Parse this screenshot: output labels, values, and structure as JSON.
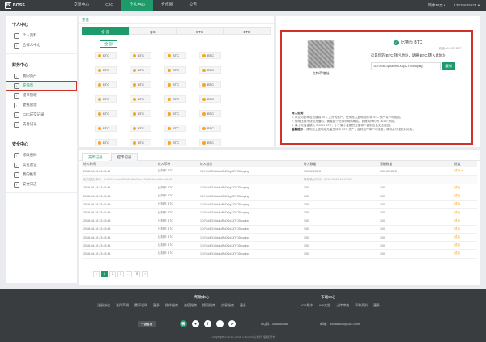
{
  "header": {
    "logo_mark": "B",
    "logo_text": "BOSS",
    "nav": [
      {
        "label": "交易中心",
        "active": false
      },
      {
        "label": "C2C",
        "active": false
      },
      {
        "label": "个人中心",
        "active": true
      },
      {
        "label": "合作屋",
        "active": false
      },
      {
        "label": "公告",
        "active": false
      }
    ],
    "language": "简体中文 ▾",
    "phone": "13225625624 ▾"
  },
  "sidebar": {
    "groups": [
      {
        "title": "个人中心",
        "items": [
          {
            "label": "个人资料",
            "icon": "user-icon",
            "active": false
          },
          {
            "label": "合作人中心",
            "icon": "partner-icon",
            "active": false
          }
        ]
      },
      {
        "title": "财务中心",
        "items": [
          {
            "label": "我的资产",
            "icon": "wallet-icon",
            "active": false
          },
          {
            "label": "充值币",
            "icon": "deposit-icon",
            "active": true
          },
          {
            "label": "提币管理",
            "icon": "withdraw-icon",
            "active": false
          },
          {
            "label": "委托管理",
            "icon": "order-icon",
            "active": false
          },
          {
            "label": "C2C成交记录",
            "icon": "record-icon",
            "active": false
          },
          {
            "label": "支付记录",
            "icon": "pay-icon",
            "active": false
          }
        ]
      },
      {
        "title": "安全中心",
        "items": [
          {
            "label": "修改密码",
            "icon": "lock-icon",
            "active": false
          },
          {
            "label": "实名验证",
            "icon": "id-icon",
            "active": false
          },
          {
            "label": "我的推荐",
            "icon": "refer-icon",
            "active": false
          },
          {
            "label": "安全日志",
            "icon": "log-icon",
            "active": false
          }
        ]
      }
    ]
  },
  "coins_panel": {
    "title": "充值",
    "tabs": [
      {
        "label": "全 部",
        "active": true
      },
      {
        "label": "QC",
        "active": false
      },
      {
        "label": "BTC",
        "active": false
      },
      {
        "label": "ETH",
        "active": false
      }
    ],
    "all_label": "全 部",
    "chips": [
      "BTC",
      "BTC",
      "BTC",
      "BTC",
      "BTC",
      "BTC",
      "BTC",
      "BTC",
      "BTC",
      "BTC",
      "BTC",
      "BTC",
      "BTC",
      "BTC",
      "BTC",
      "BTC",
      "BTC",
      "BTC",
      "BTC",
      "BTC",
      "BTC",
      "BTC",
      "BTC",
      "BTC",
      "BTC",
      "BTC",
      "BTC",
      "BTC",
      "BTC",
      "BTC",
      "BTC",
      "BTC"
    ]
  },
  "deposit": {
    "coin_name": "比特币 BTC",
    "min_note": "充值 ≥0.0001BTC",
    "qr_caption": "比特币地址",
    "hint": "这是您的 BTC 钱包地址，请将 BTC 转入此地址",
    "address": "1DYXd4fZqAkkuRkDGg3ZYCBfuqiing",
    "copy_label": "复制",
    "notes_title": "转入说明",
    "notes": [
      "1. 禁止向此地址充值除 BTC 之外的资产，任何充入此地址的非 BTC 资产将不可找回。",
      "2. 使用比特币钱包充值时，需要整个比特币网络确认，到账时间约为 30-60 分钟。",
      "3. 最小充值金额为 0.0001 BTC，小于最小金额的充值将不会到账且无法退回。"
    ],
    "warn_title": "温馨提示",
    "warn": "请勿向上述地址充值任何非 BTC 资产，否则资产将不可找回，请务必仔细核对地址。"
  },
  "records": {
    "tabs": [
      {
        "label": "充币记录",
        "active": true
      },
      {
        "label": "提币记录",
        "active": false
      }
    ],
    "columns": [
      "转入时间",
      "转入币种",
      "转入地址",
      "转入数量",
      "到账数量",
      "进度"
    ],
    "rows": [
      {
        "time": "2018-06-18 23:45:45",
        "coin": "比特币 BTC",
        "addr": "1DYXd4fZqAkkuRkDGg3ZYCBfuqiing",
        "amount": "100.1234578",
        "received": "100.1234578",
        "status": "成功 ▾"
      },
      {
        "detail": "区块链交易ID：0x3f1b7ee4c46f3d2b81a90ce1ff4d6e0a1b23c4d5e6f",
        "detail_time": "转账确认时间：2018-06-20 16:47:53"
      },
      {
        "time": "2018-06-18 23:45:45",
        "coin": "比特币 BTC",
        "addr": "1DYXd4fZqAkkuRkDGg3ZYCBfuqiing",
        "amount": "100",
        "received": "100",
        "status": "成功"
      },
      {
        "time": "2018-06-18 23:45:45",
        "coin": "比特币 BTC",
        "addr": "1DYXd4fZqAkkuRkDGg3ZYCBfuqiing",
        "amount": "100",
        "received": "100",
        "status": "成功"
      },
      {
        "time": "2018-06-18 23:45:45",
        "coin": "比特币 BTC",
        "addr": "1DYXd4fZqAkkuRkDGg3ZYCBfuqiing",
        "amount": "100",
        "received": "100",
        "status": "成功"
      },
      {
        "time": "2018-06-18 23:45:45",
        "coin": "比特币 BTC",
        "addr": "1DYXd4fZqAkkuRkDGg3ZYCBfuqiing",
        "amount": "100",
        "received": "100",
        "status": "成功"
      },
      {
        "time": "2018-06-18 23:45:45",
        "coin": "比特币 BTC",
        "addr": "1DYXd4fZqAkkuRkDGg3ZYCBfuqiing",
        "amount": "100",
        "received": "100",
        "status": "成功"
      },
      {
        "time": "2018-06-18 23:45:45",
        "coin": "比特币 BTC",
        "addr": "1DYXd4fZqAkkuRkDGg3ZYCBfuqiing",
        "amount": "100",
        "received": "100",
        "status": "成功"
      },
      {
        "time": "2018-06-18 23:45:45",
        "coin": "比特币 BTC",
        "addr": "1DYXd4fZqAkkuRkDGg3ZYCBfuqiing",
        "amount": "100",
        "received": "100",
        "status": "成功"
      },
      {
        "time": "2018-06-18 23:45:45",
        "coin": "比特币 BTC",
        "addr": "1DYXd4fZqAkkuRkDGg3ZYCBfuqiing",
        "amount": "100",
        "received": "100",
        "status": "成功"
      },
      {
        "time": "2018-06-18 23:45:45",
        "coin": "比特币 BTC",
        "addr": "1DYXd4fZqAkkuRkDGg3ZYCBfuqiing",
        "amount": "100",
        "received": "100",
        "status": "成功"
      }
    ],
    "pager": [
      "‹",
      "1",
      "2",
      "3",
      "…",
      "5",
      "›"
    ]
  },
  "footer": {
    "help_title": "帮助中心",
    "help_links": [
      "注册协议",
      "法律声明",
      "费率说明",
      "更多",
      "操作指南",
      "充值指南",
      "提现指南",
      "交易指南",
      "更多"
    ],
    "download_title": "下载中心",
    "download_links": [
      "iOS版本",
      "API文档",
      "上传审查",
      "币种资料",
      "更多"
    ],
    "badge": "一键客服",
    "social": [
      "微",
      "●",
      "f",
      "t",
      "➤"
    ],
    "qq": "QQ群：888888888",
    "email": "邮箱：88888888@163.com",
    "copyright": "Copyright ©2010-2018 CBOSS交易所 版权所有"
  },
  "colors": {
    "accent": "#1f9b6b",
    "highlight": "#d0322b",
    "coin": "#f5a623"
  }
}
